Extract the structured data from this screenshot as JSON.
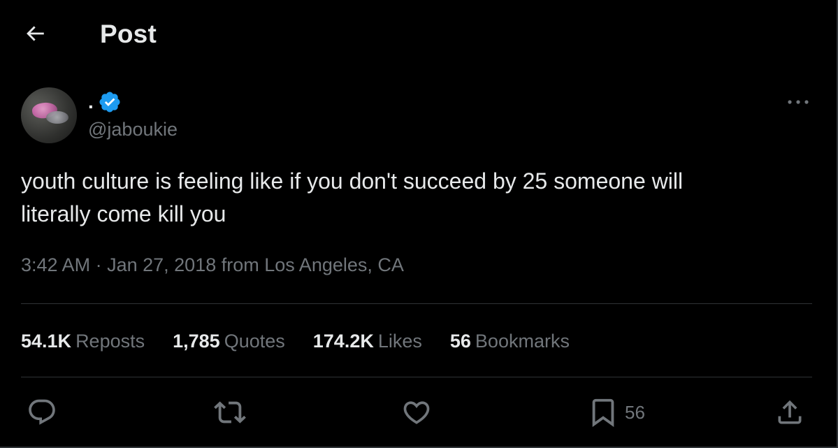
{
  "header": {
    "title": "Post",
    "back_icon": "arrow-left-icon"
  },
  "author": {
    "display_name": ".",
    "handle": "@jaboukie",
    "verified": true,
    "verified_color": "#1d9bf0"
  },
  "tweet": {
    "text": "youth culture is feeling like if you don't succeed by 25 someone will\nliterally come kill you",
    "time": "3:42 AM",
    "separator": "·",
    "date": "Jan 27, 2018",
    "location_prefix": "from",
    "location": "Los Angeles, CA"
  },
  "stats": [
    {
      "value": "54.1K",
      "label": "Reposts"
    },
    {
      "value": "1,785",
      "label": "Quotes"
    },
    {
      "value": "174.2K",
      "label": "Likes"
    },
    {
      "value": "56",
      "label": "Bookmarks"
    }
  ],
  "actions": {
    "reply_icon": "reply-icon",
    "repost_icon": "repost-icon",
    "like_icon": "heart-icon",
    "bookmark_icon": "bookmark-icon",
    "bookmark_count": "56",
    "share_icon": "share-icon"
  },
  "colors": {
    "background": "#000000",
    "text_primary": "#e7e9ea",
    "text_secondary": "#71767b",
    "divider": "#2f3336"
  }
}
